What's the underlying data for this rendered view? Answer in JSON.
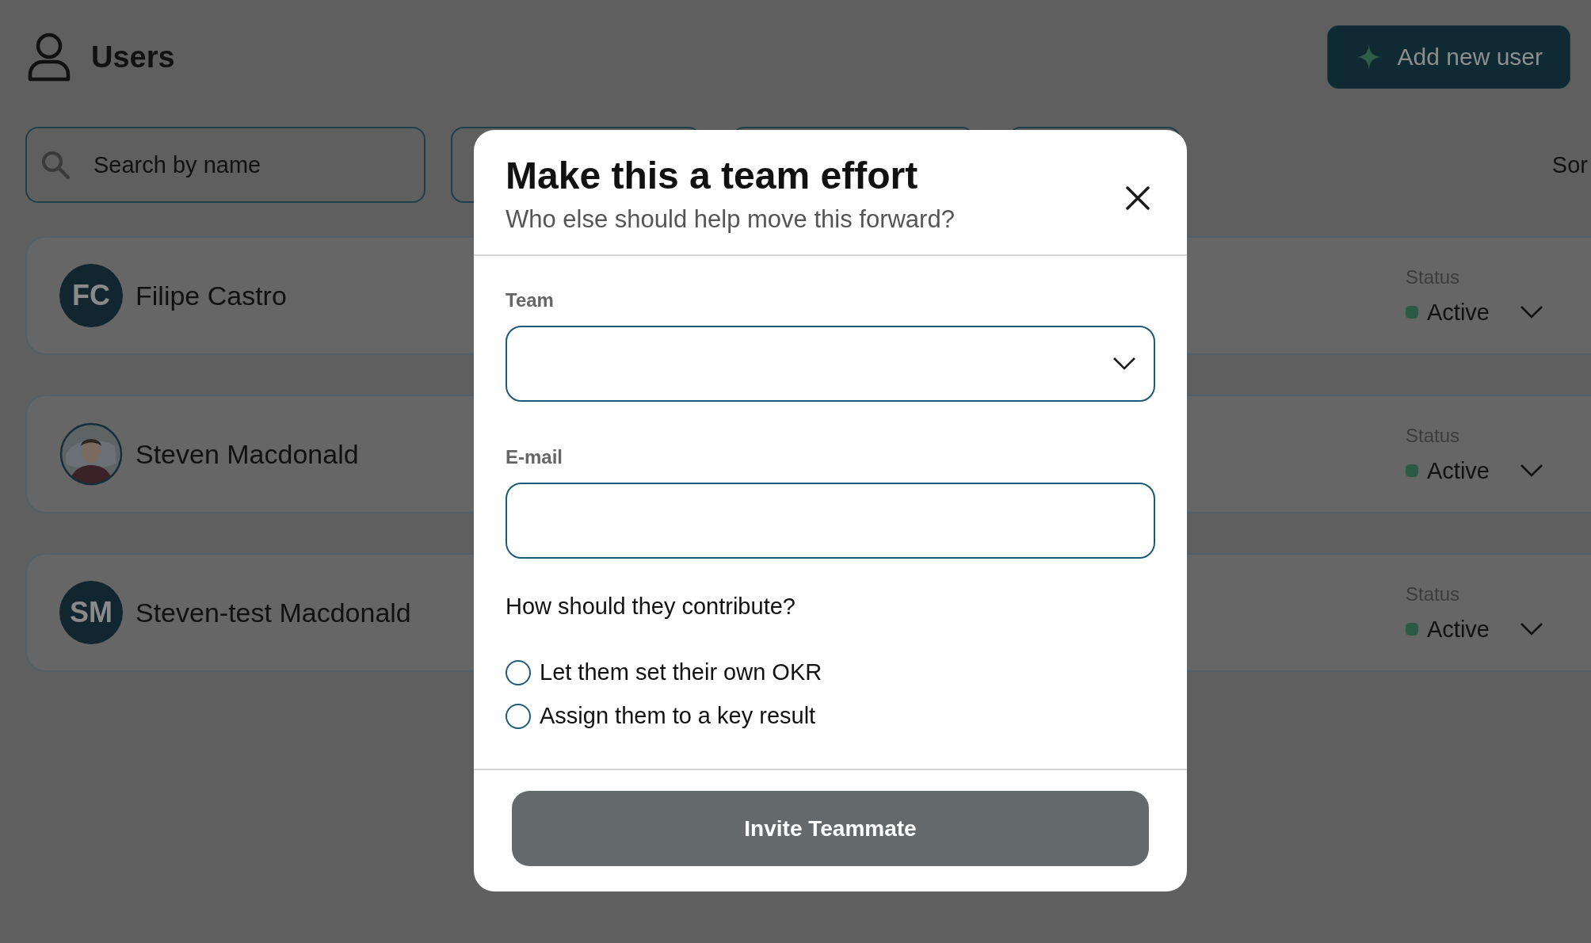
{
  "page": {
    "title": "Users",
    "add_button": "Add new user",
    "search": {
      "placeholder": "Search by name"
    },
    "sort_label": "Sor",
    "users": [
      {
        "kind": "initials",
        "initials": "FC",
        "name": "Filipe Castro",
        "status_label": "Status",
        "status": "Active"
      },
      {
        "kind": "picture",
        "name": "Steven Macdonald",
        "status_label": "Status",
        "status": "Active"
      },
      {
        "kind": "initials",
        "initials": "SM",
        "name": "Steven-test Macdonald",
        "status_label": "Status",
        "status": "Active"
      }
    ]
  },
  "modal": {
    "title": "Make this a team effort",
    "subtitle": "Who else should help move this forward?",
    "team_label": "Team",
    "email_label": "E-mail",
    "question": "How should they contribute?",
    "options": [
      {
        "label": "Let them set their own OKR",
        "selected": false
      },
      {
        "label": "Assign them to a key result",
        "selected": false
      }
    ],
    "button": {
      "label": "Invite Teammate",
      "disabled": true
    }
  }
}
